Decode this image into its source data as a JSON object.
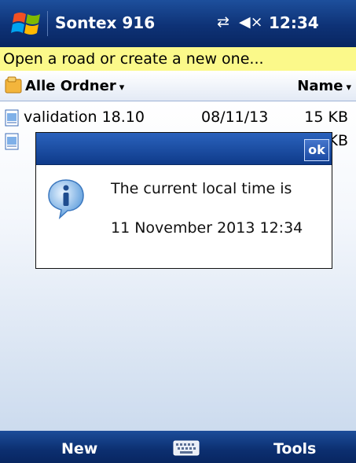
{
  "title_bar": {
    "app_title": "Sontex 916",
    "connectivity_icon": "sync-arrows-icon",
    "volume_icon": "speaker-muted-icon",
    "clock": "12:34"
  },
  "hint": {
    "text": "Open a road or create a new one..."
  },
  "header": {
    "folder_label": "Alle Ordner",
    "sort_label": "Name",
    "caret": "▾"
  },
  "files": [
    {
      "name": "validation 18.10",
      "date": "08/11/13",
      "size": "15 KB"
    },
    {
      "name": "",
      "date": "",
      "size": "KB"
    }
  ],
  "dialog": {
    "ok_label": "ok",
    "line1": "The current local time is",
    "line2": "11 November 2013 12:34"
  },
  "bottom_bar": {
    "left_softkey": "New",
    "right_softkey": "Tools",
    "keyboard_icon": "keyboard-icon"
  },
  "colors": {
    "title_bar": "#0e3276",
    "hint_background": "#fbf98a",
    "dialog_header": "#1b4aa3"
  }
}
